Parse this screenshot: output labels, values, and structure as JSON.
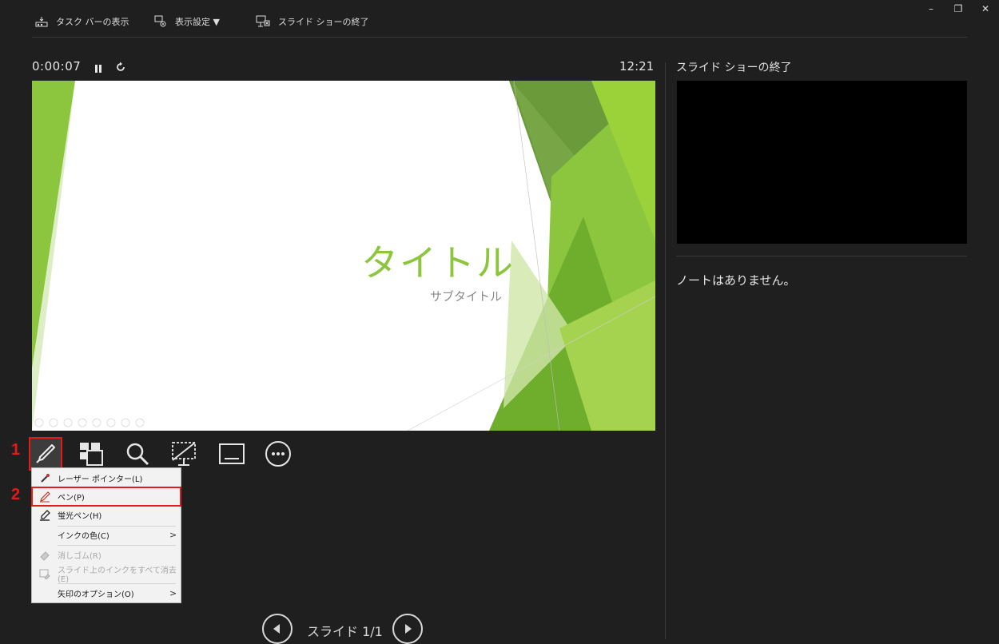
{
  "toolbar": {
    "taskbar_label": "タスク バーの表示",
    "display_settings_label": "表示設定 ▼",
    "end_show_label": "スライド ショーの終了"
  },
  "window_controls": {
    "minimize": "–",
    "restore": "❐",
    "close": "✕"
  },
  "timer": {
    "elapsed": "0:00:07",
    "clock": "12:21"
  },
  "slide": {
    "title": "タイトル",
    "subtitle": "サブタイトル",
    "accent_color": "#8cc63f"
  },
  "tools": [
    "pen-tool",
    "all-slides",
    "zoom",
    "camera",
    "subtitles",
    "more-options"
  ],
  "annotations": {
    "step1": "1",
    "step2": "2"
  },
  "menu": {
    "items": [
      {
        "label": "レーザー ポインター(L)",
        "icon": "laser-pointer-icon",
        "enabled": true,
        "submenu": false
      },
      {
        "label": "ペン(P)",
        "icon": "pen-icon",
        "enabled": true,
        "submenu": false,
        "highlighted": true
      },
      {
        "label": "蛍光ペン(H)",
        "icon": "highlighter-icon",
        "enabled": true,
        "submenu": false
      },
      {
        "label": "インクの色(C)",
        "icon": "",
        "enabled": true,
        "submenu": true
      },
      {
        "label": "消しゴム(R)",
        "icon": "eraser-icon",
        "enabled": false,
        "submenu": false
      },
      {
        "label": "スライド上のインクをすべて消去(E)",
        "icon": "erase-all-icon",
        "enabled": false,
        "submenu": false
      },
      {
        "label": "矢印のオプション(O)",
        "icon": "",
        "enabled": true,
        "submenu": true
      }
    ]
  },
  "right_pane": {
    "next_title": "スライド ショーの終了",
    "notes": "ノートはありません。"
  },
  "nav": {
    "slide_label": "スライド 1/1"
  }
}
